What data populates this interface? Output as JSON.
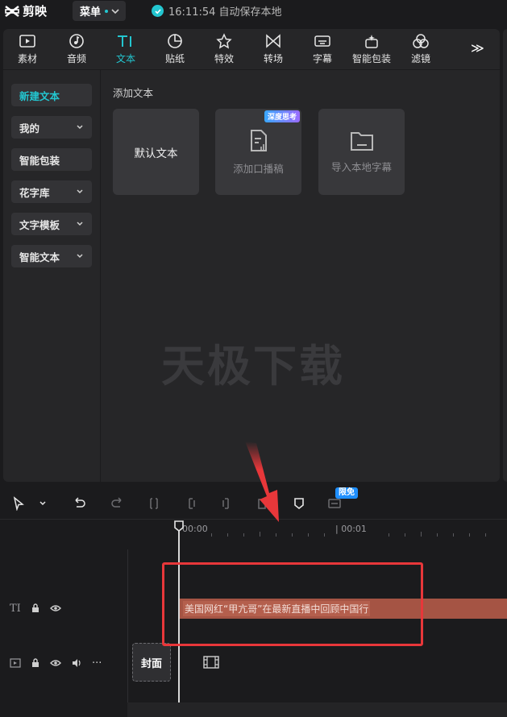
{
  "app": {
    "name": "剪映",
    "menu_label": "菜单",
    "save_status": "16:11:54 自动保存本地"
  },
  "toolbar": {
    "items": [
      {
        "label": "素材",
        "icon": "media-icon"
      },
      {
        "label": "音频",
        "icon": "audio-icon"
      },
      {
        "label": "文本",
        "icon": "text-icon",
        "active": true
      },
      {
        "label": "贴纸",
        "icon": "sticker-icon"
      },
      {
        "label": "特效",
        "icon": "effects-icon"
      },
      {
        "label": "转场",
        "icon": "transition-icon"
      },
      {
        "label": "字幕",
        "icon": "subtitle-icon"
      },
      {
        "label": "智能包装",
        "icon": "smart-pack-icon"
      },
      {
        "label": "滤镜",
        "icon": "filter-icon"
      }
    ],
    "more": "≫"
  },
  "sidebar": {
    "items": [
      {
        "label": "新建文本",
        "active": true,
        "chevron": false
      },
      {
        "label": "我的",
        "chevron": true
      },
      {
        "label": "智能包装",
        "chevron": false
      },
      {
        "label": "花字库",
        "chevron": true
      },
      {
        "label": "文字模板",
        "chevron": true
      },
      {
        "label": "智能文本",
        "chevron": true
      }
    ]
  },
  "content": {
    "title": "添加文本",
    "cards": [
      {
        "label": "默认文本"
      },
      {
        "label": "添加口播稿",
        "badge": "深度思考"
      },
      {
        "label": "导入本地字幕"
      }
    ],
    "watermark": "天极下载"
  },
  "timeline": {
    "limited_badge": "限免",
    "ruler_labels": [
      "00:00",
      "| 00:01"
    ],
    "text_clip": "美国网红“甲亢哥”在最新直播中回顾中国行",
    "cover_label": "封面",
    "track_text_icon": "TI"
  },
  "colors": {
    "accent": "#23c6d0",
    "clip": "#a55444",
    "annotation": "#e8373a"
  }
}
